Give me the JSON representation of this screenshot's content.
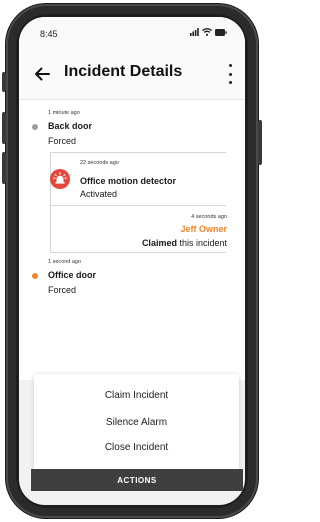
{
  "status": {
    "time": "8:45"
  },
  "header": {
    "title": "Incident Details"
  },
  "events": [
    {
      "time": "1 minute ago",
      "name": "Back door",
      "state": "Forced"
    },
    {
      "time": "22 seconds ago",
      "name": "Office motion detector",
      "state": "Activated"
    },
    {
      "time": "4 seconds ago",
      "user": "Jeff Owner",
      "action_bold": "Claimed",
      "action_rest": "this incident"
    },
    {
      "time": "1 second ago",
      "name": "Office door",
      "state": "Forced"
    }
  ],
  "sheet": {
    "items": [
      "Claim Incident",
      "Silence Alarm",
      "Close Incident"
    ]
  },
  "footer": {
    "actions_label": "ACTIONS"
  },
  "colors": {
    "accent": "#F0862C",
    "alert": "#E5483A",
    "dot_grey": "#9E9E9E"
  }
}
